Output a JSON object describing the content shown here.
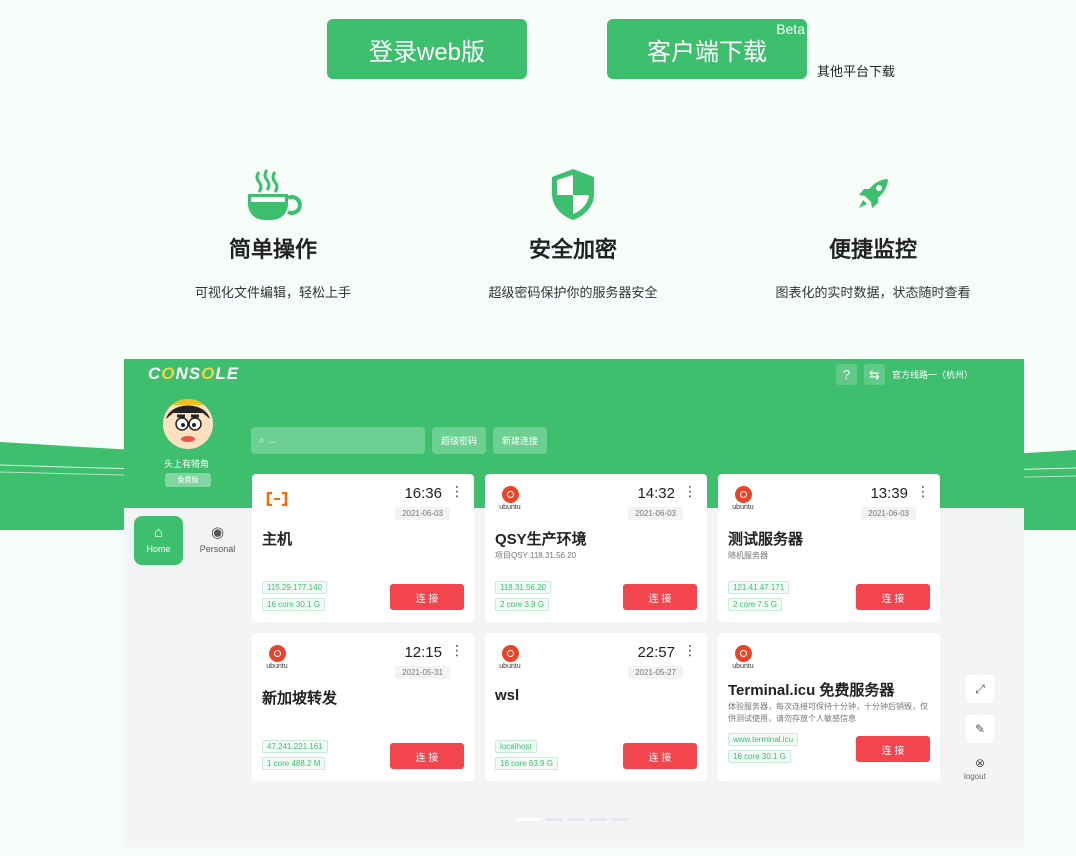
{
  "top": {
    "web_login": "登录web版",
    "client_download": "客户端下载",
    "beta": "Beta",
    "other_platforms": "其他平台下载"
  },
  "features": [
    {
      "title": "简单操作",
      "desc": "可视化文件编辑，轻松上手",
      "icon": "coffee-icon"
    },
    {
      "title": "安全加密",
      "desc": "超级密码保护你的服务器安全",
      "icon": "shield-icon"
    },
    {
      "title": "便捷监控",
      "desc": "图表化的实时数据，状态随时查看",
      "icon": "rocket-icon"
    }
  ],
  "console": {
    "logo": "CONSOLE",
    "line": "官方线路一（杭州）",
    "user_name": "头上有犄角",
    "plan": "免费版",
    "search_placeholder": "...",
    "super_password": "超级密码",
    "new_connection": "新建连接",
    "nav": {
      "home": "Home",
      "personal": "Personal"
    },
    "logout": "logout",
    "servers": [
      {
        "logo": "alibaba",
        "time": "16:36",
        "date": "2021-06-03",
        "name": "主机",
        "desc": "",
        "ip": "115.29.177.140",
        "spec": "16 core 30.1 G",
        "connect": "连 接"
      },
      {
        "logo": "ubuntu",
        "time": "14:32",
        "date": "2021-06-03",
        "name": "QSY生产环境",
        "desc": "项目QSY 118.31.56.20",
        "ip": "118.31.56.20",
        "spec": "2 core 3.9 G",
        "connect": "连 接"
      },
      {
        "logo": "ubuntu",
        "time": "13:39",
        "date": "2021-06-03",
        "name": "测试服务器",
        "desc": "随机服务器",
        "ip": "121.41.47.171",
        "spec": "2 core 7.5 G",
        "connect": "连 接"
      },
      {
        "logo": "ubuntu",
        "time": "12:15",
        "date": "2021-05-31",
        "name": "新加坡转发",
        "desc": "",
        "ip": "47.241.221.161",
        "spec": "1 core 488.2 M",
        "connect": "连 接"
      },
      {
        "logo": "ubuntu",
        "time": "22:57",
        "date": "2021-05-27",
        "name": "wsl",
        "desc": "",
        "ip": "localhost",
        "spec": "16 core 63.9 G",
        "connect": "连 接"
      },
      {
        "logo": "ubuntu",
        "time": "",
        "date": "",
        "name": "Terminal.icu 免费服务器",
        "desc": "体验服务器，每次连接可保持十分钟，十分钟后销毁，仅供测试使用，请勿存放个人敏感信息",
        "ip": "www.terminal.icu",
        "spec": "16 core 30.1 G",
        "connect": "连 接"
      }
    ],
    "ubuntu_label": "ubuntu"
  },
  "colors": {
    "brand_green": "#3dbf6e",
    "connect_red": "#f2454d",
    "accent_yellow": "#f7d43b"
  }
}
